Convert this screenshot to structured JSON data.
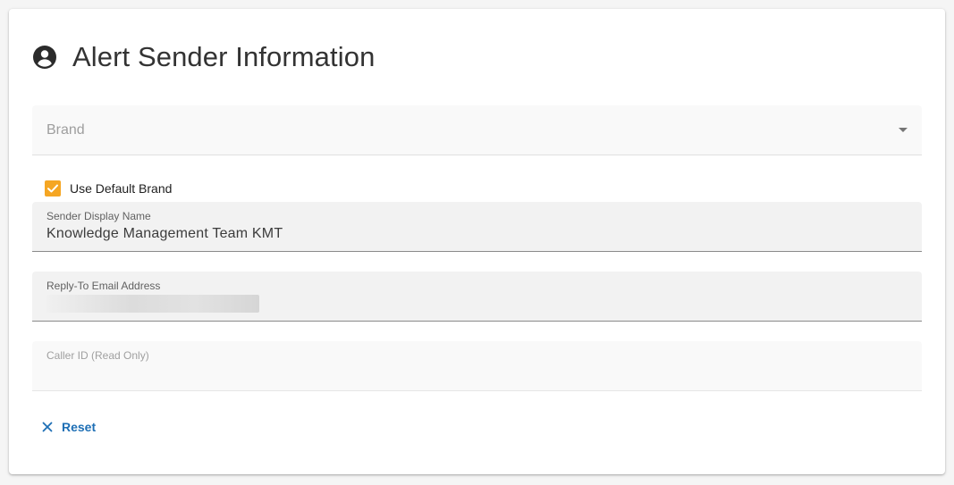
{
  "header": {
    "icon": "account-circle-icon",
    "title": "Alert Sender Information"
  },
  "brand_select": {
    "placeholder": "Brand",
    "icon": "dropdown-arrow-icon"
  },
  "use_default_brand": {
    "label": "Use Default Brand",
    "checked": true,
    "color": "#f5a623"
  },
  "sender_display_name": {
    "label": "Sender Display Name",
    "value": "Knowledge Management Team KMT"
  },
  "reply_to_email": {
    "label": "Reply-To Email Address"
  },
  "caller_id": {
    "label": "Caller ID (Read Only)",
    "value": ""
  },
  "reset": {
    "label": "Reset",
    "icon": "close-icon",
    "color": "#1e6fb5"
  }
}
